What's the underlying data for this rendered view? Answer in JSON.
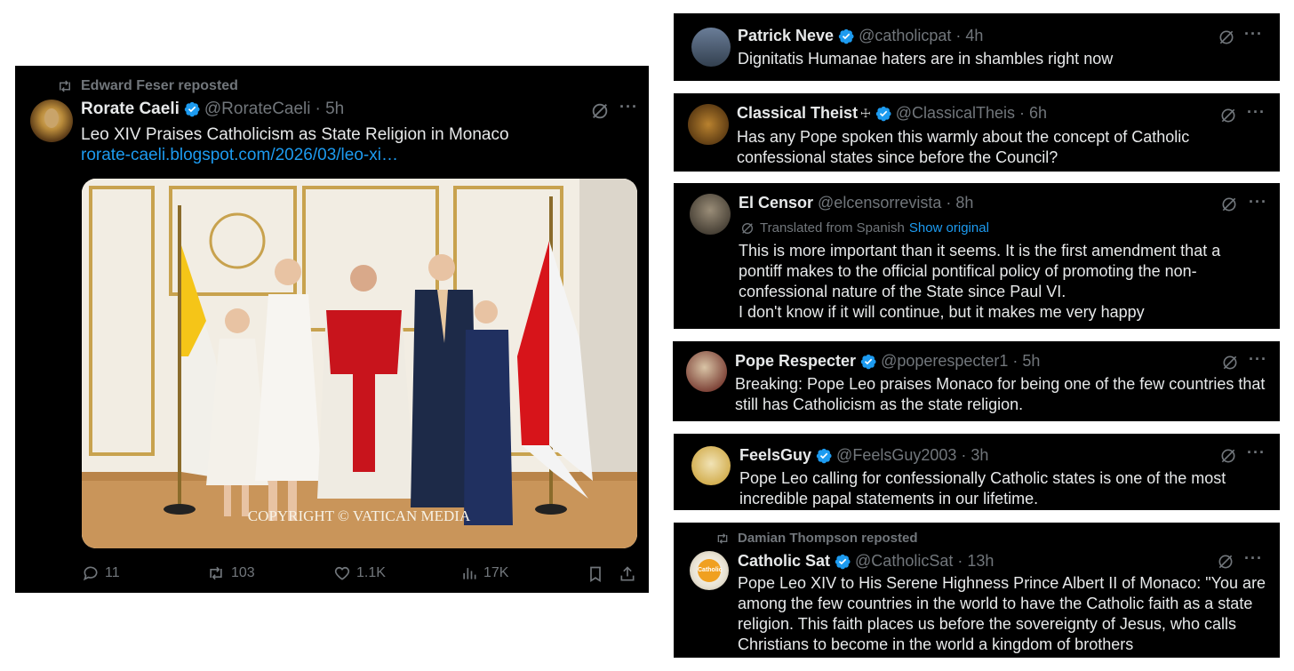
{
  "main_post": {
    "repost_label": "Edward Feser reposted",
    "author": "Rorate Caeli",
    "handle": "@RorateCaeli",
    "time": "· 5h",
    "text": "Leo XIV Praises Catholicism as State Religion in Monaco",
    "link": "rorate-caeli.blogspot.com/2026/03/leo-xi…",
    "image_caption": "COPYRIGHT © VATICAN MEDIA",
    "actions": {
      "replies": "11",
      "reposts": "103",
      "likes": "1.1K",
      "views": "17K"
    }
  },
  "replies": [
    {
      "name": "Patrick Neve",
      "handle": "@catholicpat",
      "time": "· 4h",
      "text": "Dignitatis Humanae haters are in shambles right now"
    },
    {
      "name": "Classical Theist",
      "name_suffix": "☩",
      "handle": "@ClassicalTheis",
      "time": "· 6h",
      "text_lines": [
        "Has any Pope spoken this warmly about the concept of Catholic",
        "confessional states since before the Council?"
      ]
    },
    {
      "name": "El Censor",
      "handle": "@elcensorrevista",
      "time": "· 8h",
      "translated": "Translated from Spanish",
      "show_original": "Show original",
      "text_lines": [
        "This is more important than it seems. It is the first amendment that a",
        "pontiff makes to the official pontifical policy of promoting the non-",
        "confessional nature of the State since Paul VI.",
        "I don't know if it will continue, but it makes me very happy"
      ]
    },
    {
      "name": "Pope Respecter",
      "handle": "@poperespecter1",
      "time": "· 5h",
      "text_lines": [
        "Breaking: Pope Leo praises Monaco for being one of the few countries that",
        "still has Catholicism as the state religion."
      ]
    },
    {
      "name": "FeelsGuy",
      "handle": "@FeelsGuy2003",
      "time": "· 3h",
      "text_lines": [
        "Pope Leo calling for confessionally Catholic states is one of the most",
        "incredible papal statements in our lifetime."
      ]
    },
    {
      "repost_label": "Damian Thompson reposted",
      "name": "Catholic Sat",
      "handle": "@CatholicSat",
      "time": "· 13h",
      "avatar_text": "Catholic Sat",
      "text_lines": [
        "Pope Leo XIV to His Serene Highness Prince Albert II of Monaco: \"You are",
        "among the few countries in the world to have the Catholic faith as a state",
        "religion. This faith places us before the sovereignty of Jesus, who calls",
        "Christians to become in the world a kingdom of brothers"
      ]
    }
  ],
  "colors": {
    "background": "#000000",
    "text": "#e7e9ea",
    "muted": "#71767b",
    "link": "#1d9bf0",
    "verified": "#1d9bf0"
  }
}
